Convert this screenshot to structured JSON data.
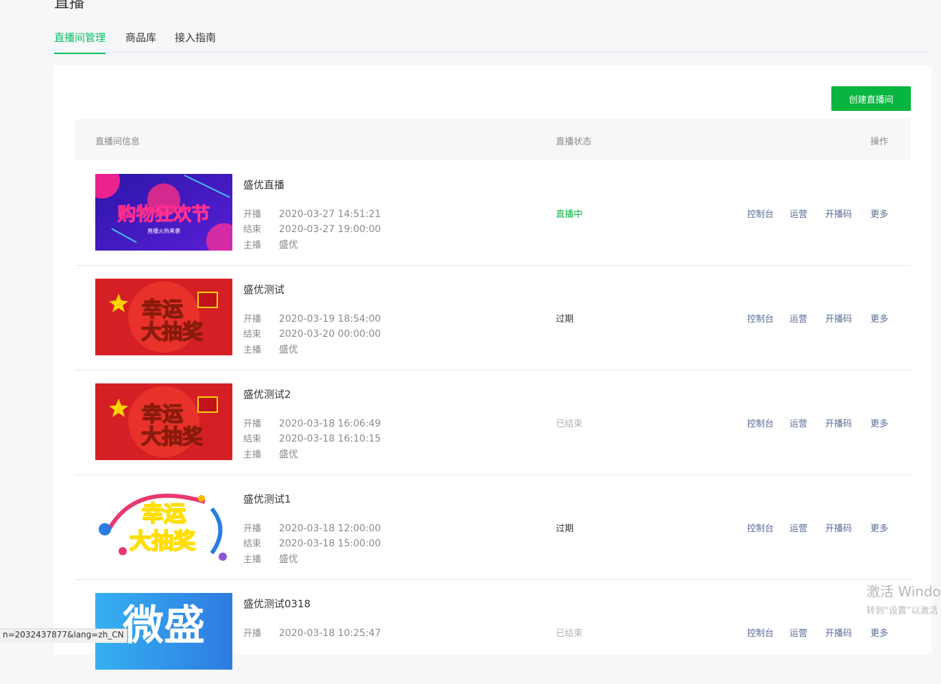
{
  "header": {
    "title": "直播"
  },
  "tabs": [
    {
      "label": "直播间管理",
      "active": true
    },
    {
      "label": "商品库",
      "active": false
    },
    {
      "label": "接入指南",
      "active": false
    }
  ],
  "create_button": "创建直播间",
  "table": {
    "columns": {
      "info": "直播间信息",
      "status": "直播状态",
      "actions": "操作"
    },
    "labels": {
      "start": "开播",
      "end": "结束",
      "host": "主播"
    },
    "actions": {
      "console": "控制台",
      "operate": "运营",
      "code": "开播码",
      "more": "更多"
    },
    "rows": [
      {
        "name": "盛优直播",
        "start": "2020-03-27 14:51:21",
        "end": "2020-03-27 19:00:00",
        "host": "盛优",
        "status": "直播中",
        "status_type": "live",
        "cover": {
          "main": "购物狂欢节",
          "sub": "直播火热来袭"
        }
      },
      {
        "name": "盛优测试",
        "start": "2020-03-19 18:54:00",
        "end": "2020-03-20 00:00:00",
        "host": "盛优",
        "status": "过期",
        "status_type": "expired",
        "cover": {
          "line1": "幸运",
          "line2": "大抽奖"
        }
      },
      {
        "name": "盛优测试2",
        "start": "2020-03-18 16:06:49",
        "end": "2020-03-18 16:10:15",
        "host": "盛优",
        "status": "已结束",
        "status_type": "ended",
        "cover": {
          "line1": "幸运",
          "line2": "大抽奖"
        }
      },
      {
        "name": "盛优测试1",
        "start": "2020-03-18 12:00:00",
        "end": "2020-03-18 15:00:00",
        "host": "盛优",
        "status": "过期",
        "status_type": "expired",
        "cover": {
          "line1": "幸运",
          "line2": "大抽奖"
        }
      },
      {
        "name": "盛优测试0318",
        "start": "2020-03-18 10:25:47",
        "status": "已结束",
        "status_type": "ended",
        "cover": {
          "text": "微盛"
        }
      }
    ]
  },
  "statusbar": {
    "url": "n=2032437877&lang=zh_CN"
  },
  "watermark": {
    "line1": "激活 Windo",
    "line2": "转到“设置”以激活"
  }
}
